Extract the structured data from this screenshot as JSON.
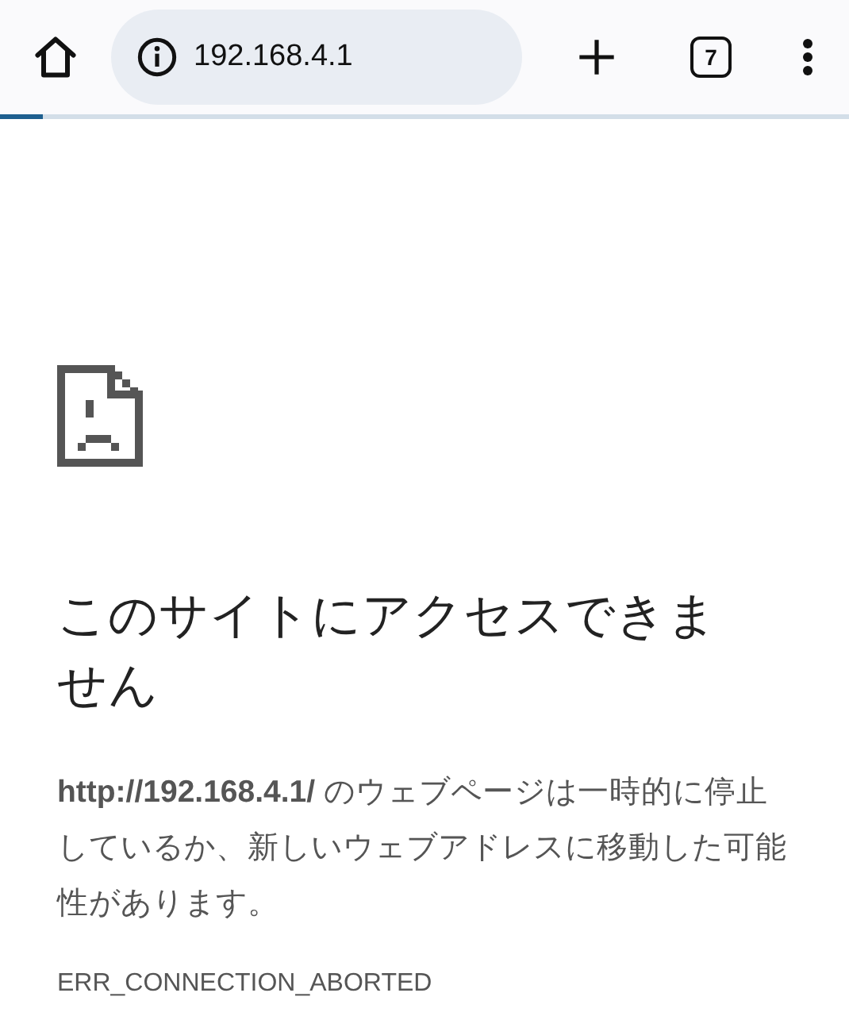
{
  "toolbar": {
    "address": "192.168.4.1",
    "tab_count": "7",
    "progress": {
      "level": 0.05
    }
  },
  "error": {
    "title": "このサイトにアクセスできません",
    "message": "**http://192.168.4.1/** のウェブページは一時的に停止しているか、新しいウェブアドレスに移動した可能性があります。",
    "code": "ERR_CONNECTION_ABORTED"
  }
}
